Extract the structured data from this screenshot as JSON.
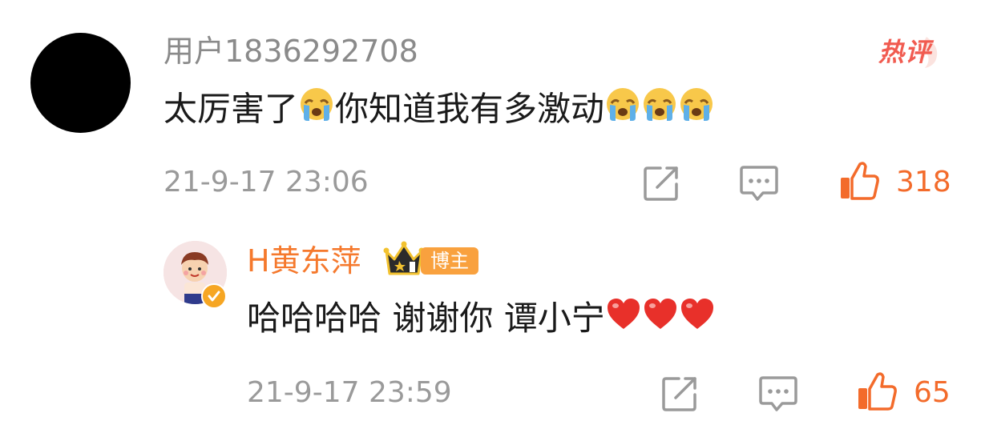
{
  "comment": {
    "username": "用户1836292708",
    "text_part1": "太厉害了",
    "text_part2": "你知道我有多激动",
    "timestamp": "21-9-17 23:06",
    "likes": "318",
    "hot_badge": "热评"
  },
  "reply": {
    "username": "H黄东萍",
    "author_badge": "博主",
    "text": "哈哈哈哈 谢谢你 谭小宁",
    "timestamp": "21-9-17 23:59",
    "likes": "65"
  },
  "colors": {
    "like": "#f36b2b",
    "hot": "#f15b50",
    "reply_name": "#f5792d",
    "badge": "#f9a13e",
    "meta_gray": "#9a9a9a"
  },
  "icons": [
    "share-edit-icon",
    "comment-icon",
    "like-thumb-icon",
    "crying-emoji",
    "red-heart-emoji",
    "crown-icon",
    "verified-icon"
  ]
}
